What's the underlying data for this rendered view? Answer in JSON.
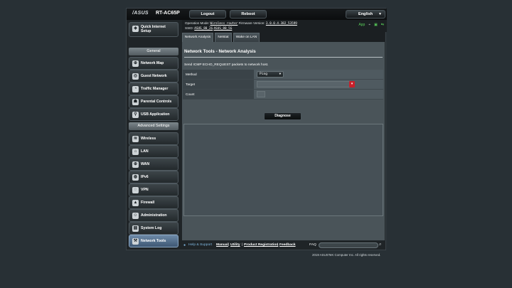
{
  "header": {
    "logo": "/ASUS",
    "model": "RT-AC65P",
    "logout_label": "Logout",
    "reboot_label": "Reboot",
    "language": "English"
  },
  "infobar": {
    "op_mode_label": "Operation Mode:",
    "op_mode_value": "Wireless router",
    "firmware_label": "Firmware Version:",
    "firmware_value": "3.0.0.4.382_53599",
    "ssid_label": "SSID:",
    "ssid_2g": "ASUS_80_2G",
    "ssid_5g": "ASUS_80_5G",
    "app_label": "App",
    "status_color": "#59d15a"
  },
  "sidebar": {
    "quick_setup": "Quick Internet Setup",
    "general_header": "General",
    "general_items": [
      {
        "label": "Network Map",
        "icon": "network-map-icon"
      },
      {
        "label": "Guest Network",
        "icon": "guest-network-icon"
      },
      {
        "label": "Traffic Manager",
        "icon": "traffic-manager-icon"
      },
      {
        "label": "Parental Controls",
        "icon": "parental-controls-icon"
      },
      {
        "label": "USB Application",
        "icon": "usb-icon"
      }
    ],
    "advanced_header": "Advanced Settings",
    "advanced_items": [
      {
        "label": "Wireless",
        "icon": "wireless-icon"
      },
      {
        "label": "LAN",
        "icon": "lan-icon"
      },
      {
        "label": "WAN",
        "icon": "wan-icon"
      },
      {
        "label": "IPv6",
        "icon": "ipv6-icon"
      },
      {
        "label": "VPN",
        "icon": "vpn-icon"
      },
      {
        "label": "Firewall",
        "icon": "firewall-icon"
      },
      {
        "label": "Administration",
        "icon": "administration-icon"
      },
      {
        "label": "System Log",
        "icon": "system-log-icon"
      },
      {
        "label": "Network Tools",
        "icon": "network-tools-icon",
        "selected": true
      }
    ]
  },
  "tabs": [
    {
      "label": "Network Analysis",
      "active": true
    },
    {
      "label": "Netstat",
      "active": false
    },
    {
      "label": "Wake on LAN",
      "active": false
    }
  ],
  "main": {
    "title": "Network Tools - Network Analysis",
    "description": "Send ICMP ECHO_REQUEST packets to network host.",
    "form": {
      "method_label": "Method",
      "method_value": "Ping",
      "target_label": "Target",
      "target_value": "",
      "count_label": "Count",
      "count_value": ""
    },
    "diagnose_label": "Diagnose",
    "output": ""
  },
  "footer": {
    "help_label": "Help & Support",
    "manual": "Manual",
    "utility": "Utility",
    "product_registration": "Product Registration",
    "feedback": "Feedback",
    "faq_label": "FAQ",
    "faq_placeholder": ""
  },
  "copyright": "2019 ASUSTeK Computer Inc. All rights reserved."
}
